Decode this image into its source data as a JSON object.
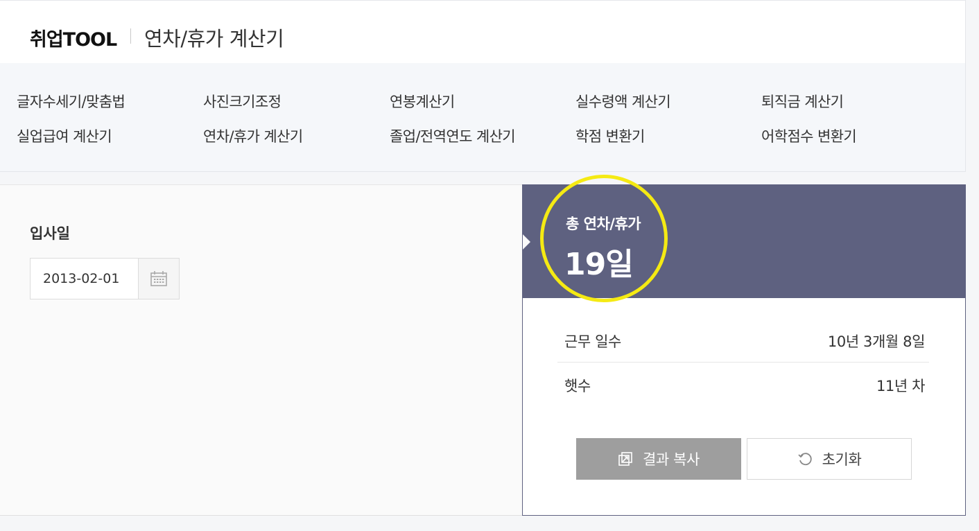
{
  "header": {
    "brand": "취업TOOL",
    "page_title": "연차/휴가 계산기"
  },
  "nav": {
    "row1": [
      "글자수세기/맞춤법",
      "사진크기조정",
      "연봉계산기",
      "실수령액 계산기",
      "퇴직금 계산기"
    ],
    "row2": [
      "실업급여 계산기",
      "연차/휴가 계산기",
      "졸업/전역연도 계산기",
      "학점 변환기",
      "어학점수 변환기"
    ]
  },
  "form": {
    "label": "입사일",
    "date_value": "2013-02-01"
  },
  "result": {
    "total_label": "총 연차/휴가",
    "total_value": "19일",
    "highlight_color": "#f5ea13",
    "head_color": "#5e6180",
    "rows": [
      {
        "key": "근무 일수",
        "value": "10년 3개월 8일"
      },
      {
        "key": "햇수",
        "value": "11년 차"
      }
    ],
    "copy_button": "결과 복사",
    "reset_button": "초기화",
    "copy_icon": "copy-icon",
    "reset_icon": "refresh-icon"
  }
}
